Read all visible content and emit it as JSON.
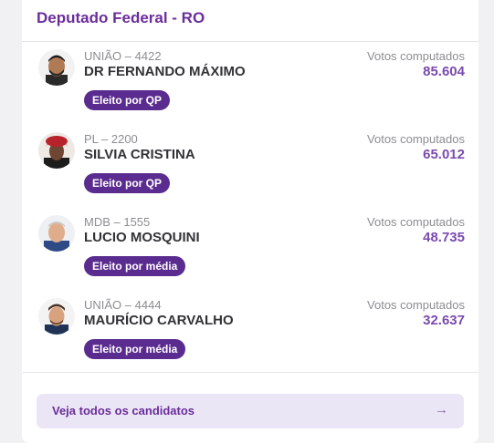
{
  "card": {
    "title": "Deputado Federal - RO"
  },
  "candidates": [
    {
      "party": "UNIÃO – 4422",
      "name": "DR FERNANDO MÁXIMO",
      "badge": "Eleito por QP",
      "votes_label": "Votos computados",
      "votes": "85.604"
    },
    {
      "party": "PL – 2200",
      "name": "SILVIA CRISTINA",
      "badge": "Eleito por QP",
      "votes_label": "Votos computados",
      "votes": "65.012"
    },
    {
      "party": "MDB – 1555",
      "name": "LUCIO MOSQUINI",
      "badge": "Eleito por média",
      "votes_label": "Votos computados",
      "votes": "48.735"
    },
    {
      "party": "UNIÃO – 4444",
      "name": "MAURÍCIO CARVALHO",
      "badge": "Eleito por média",
      "votes_label": "Votos computados",
      "votes": "32.637"
    }
  ],
  "footer": {
    "cta_label": "Veja todos os candidatos",
    "cta_icon": "arrow-right-icon"
  },
  "colors": {
    "title": "#6a2d9a",
    "badge_bg": "#5b2c8f",
    "votes": "#7a4bb0",
    "cta_bg": "#ebe6f5"
  }
}
